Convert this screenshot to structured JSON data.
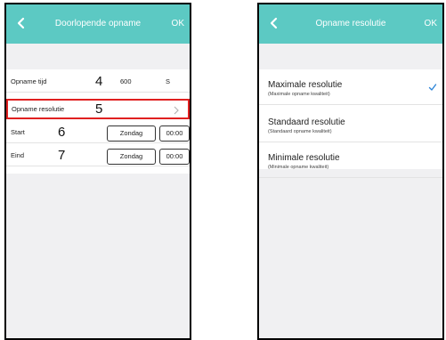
{
  "left_screen": {
    "title": "Doorlopende opname",
    "ok_label": "OK",
    "rows": {
      "recording_time": {
        "label": "Opname tijd",
        "marker": "4",
        "value": "600",
        "unit": "S"
      },
      "resolution": {
        "label": "Opname resolutie",
        "marker": "5"
      },
      "start": {
        "label": "Start",
        "marker": "6",
        "day": "Zondag",
        "time": "00:00"
      },
      "end": {
        "label": "Eind",
        "marker": "7",
        "day": "Zondag",
        "time": "00:00"
      }
    }
  },
  "right_screen": {
    "title": "Opname resolutie",
    "ok_label": "OK",
    "options": [
      {
        "title": "Maximale resolutie",
        "subtitle": "(Maximale opname kwaliteit)",
        "selected": true
      },
      {
        "title": "Standaard resolutie",
        "subtitle": "(Standaard opname kwaliteit)",
        "selected": false
      },
      {
        "title": "Minimale resolutie",
        "subtitle": "(Minimale opname kwaliteit)",
        "selected": false
      }
    ]
  },
  "colors": {
    "header": "#5cc9c3",
    "highlight": "#e02020",
    "check": "#2f86d8"
  },
  "icons": [
    "back-arrow-icon",
    "chevron-right-icon",
    "checkmark-icon"
  ]
}
